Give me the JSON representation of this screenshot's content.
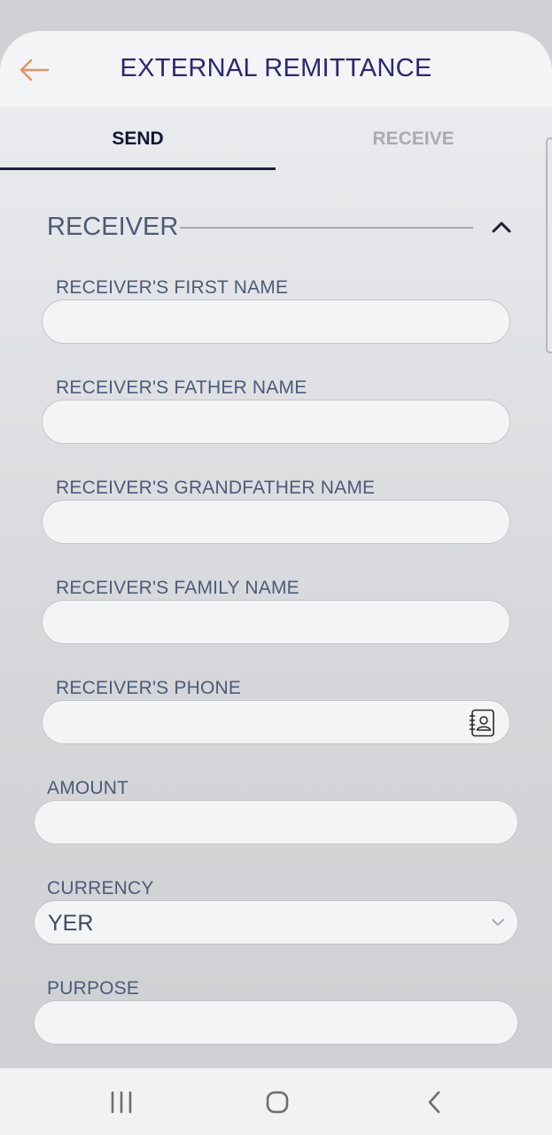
{
  "header": {
    "title": "EXTERNAL REMITTANCE",
    "back_icon": "arrow-left-icon",
    "back_color": "#e98f63"
  },
  "tabs": [
    {
      "label": "SEND",
      "active": true
    },
    {
      "label": "RECEIVE",
      "active": false
    }
  ],
  "section": {
    "title": "RECEIVER",
    "expanded": true,
    "toggle_icon": "chevron-up-icon"
  },
  "form": {
    "first_name": {
      "label": "RECEIVER'S FIRST NAME",
      "value": ""
    },
    "father_name": {
      "label": "RECEIVER'S FATHER NAME",
      "value": ""
    },
    "grandfather_name": {
      "label": "RECEIVER'S GRANDFATHER NAME",
      "value": ""
    },
    "family_name": {
      "label": "RECEIVER'S FAMILY NAME",
      "value": ""
    },
    "phone": {
      "label": "RECEIVER'S PHONE",
      "value": "",
      "icon": "contact-book-icon"
    },
    "amount": {
      "label": "AMOUNT",
      "value": ""
    },
    "currency": {
      "label": "CURRENCY",
      "value": "YER",
      "icon": "chevron-down-icon"
    },
    "purpose": {
      "label": "PURPOSE",
      "value": ""
    }
  },
  "navbar": {
    "recents_icon": "recent-apps-icon",
    "home_icon": "home-icon",
    "back_icon": "back-icon"
  },
  "colors": {
    "title": "#2c2770",
    "active_tab": "#0f1633",
    "inactive_tab": "#a9abb5",
    "label": "#4b5b79"
  }
}
